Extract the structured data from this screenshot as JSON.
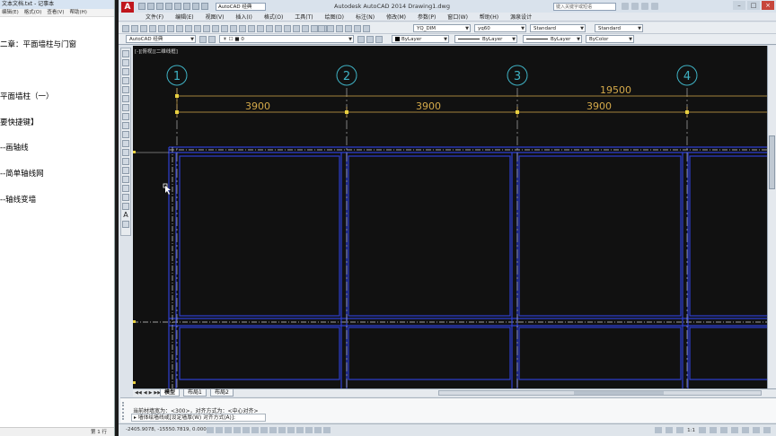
{
  "notepad": {
    "title": "文本文档.txt - 记事本",
    "menu": [
      "编辑(E)",
      "格式(O)",
      "查看(V)",
      "帮助(H)"
    ],
    "lines": [
      "二章：平面墙柱与门窗",
      "",
      "平面墙柱（一）",
      "要快捷键】",
      "--画轴线",
      "--简单轴线网",
      "--轴线变墙"
    ],
    "status": "第 1 行"
  },
  "acad": {
    "app_logo": "A",
    "workspace": "AutoCAD 经典",
    "title": "Autodesk AutoCAD 2014    Drawing1.dwg",
    "search_placeholder": "键入关键字或短语",
    "window_controls": [
      "–",
      "□",
      "×"
    ],
    "menu": [
      "文件(F)",
      "编辑(E)",
      "视图(V)",
      "插入(I)",
      "格式(O)",
      "工具(T)",
      "绘图(D)",
      "标注(N)",
      "修改(M)",
      "参数(P)",
      "窗口(W)",
      "帮助(H)",
      "源泉设计"
    ],
    "toolbar1": {
      "dim_style": "YQ_DIM",
      "text_style": "yq60",
      "table_style": "Standard",
      "mleader_style": "Standard"
    },
    "toolbar2": {
      "workspace": "AutoCAD 经典",
      "layer": "0",
      "color": "ByLayer",
      "linetype": "ByLayer",
      "lineweight": "ByLayer",
      "plot_style": "ByColor"
    },
    "viewport_label": "[-][俯视][二维线框]",
    "layout_tabs": [
      "模型",
      "布局1",
      "布局2"
    ],
    "command": {
      "history": "当前材墙宽为：<300>，对齐方式为：<中心对齐>",
      "input": "墙体绘墙线或[设定墙厚(W) 对齐方式(A)]:"
    },
    "coordinates": "-2405.9078, -15550.7819, 0.0000",
    "status_right": "1:1"
  },
  "drawing": {
    "axis_labels": [
      "1",
      "2",
      "3",
      "4"
    ],
    "total_dimension": "19500",
    "bay_dimensions": [
      "3900",
      "3900",
      "3900"
    ],
    "colors": {
      "background": "#111111",
      "axis_bubble": "#3fb2c4",
      "dimension": "#d4a94a",
      "wall": "#2e3fd0",
      "axis_line": "#c8c8c8"
    }
  }
}
